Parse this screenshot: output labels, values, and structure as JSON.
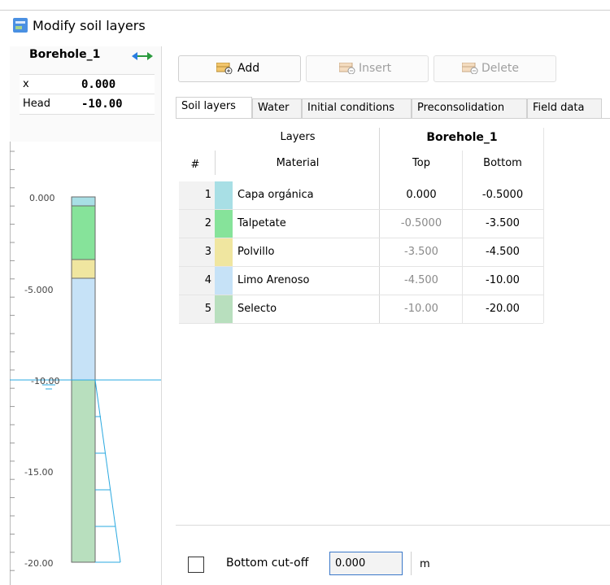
{
  "window": {
    "title": "Modify soil layers"
  },
  "borehole": {
    "name": "Borehole_1",
    "props": [
      {
        "label": "x",
        "value": "0.000"
      },
      {
        "label": "Head",
        "value": "-10.00"
      }
    ],
    "axis_labels": [
      "0.000",
      "-5.000",
      "-10.00",
      "-15.00",
      "-20.00"
    ]
  },
  "toolbar": {
    "add_label": "Add",
    "insert_label": "Insert",
    "delete_label": "Delete"
  },
  "tabs": [
    {
      "label": "Soil layers",
      "active": true
    },
    {
      "label": "Water",
      "active": false
    },
    {
      "label": "Initial conditions",
      "active": false
    },
    {
      "label": "Preconsolidation",
      "active": false
    },
    {
      "label": "Field data",
      "active": false
    }
  ],
  "table": {
    "group_header_layers": "Layers",
    "group_header_borehole": "Borehole_1",
    "col_num": "#",
    "col_material": "Material",
    "col_top": "Top",
    "col_bottom": "Bottom",
    "rows": [
      {
        "n": "1",
        "material": "Capa orgánica",
        "top": "0.000",
        "bottom": "-0.5000",
        "color": "#a8dfe5"
      },
      {
        "n": "2",
        "material": "Talpetate",
        "top": "-0.5000",
        "bottom": "-3.500",
        "color": "#86e39a"
      },
      {
        "n": "3",
        "material": "Polvillo",
        "top": "-3.500",
        "bottom": "-4.500",
        "color": "#f0e6a0"
      },
      {
        "n": "4",
        "material": "Limo Arenoso",
        "top": "-4.500",
        "bottom": "-10.00",
        "color": "#c6e2f7"
      },
      {
        "n": "5",
        "material": "Selecto",
        "top": "-10.00",
        "bottom": "-20.00",
        "color": "#b8dfbe"
      }
    ]
  },
  "bottom_cutoff": {
    "label": "Bottom cut-off",
    "value": "0.000",
    "unit": "m",
    "checked": false
  },
  "colors": {
    "water_line": "#29a8e0",
    "accent": "#3a78c9"
  }
}
